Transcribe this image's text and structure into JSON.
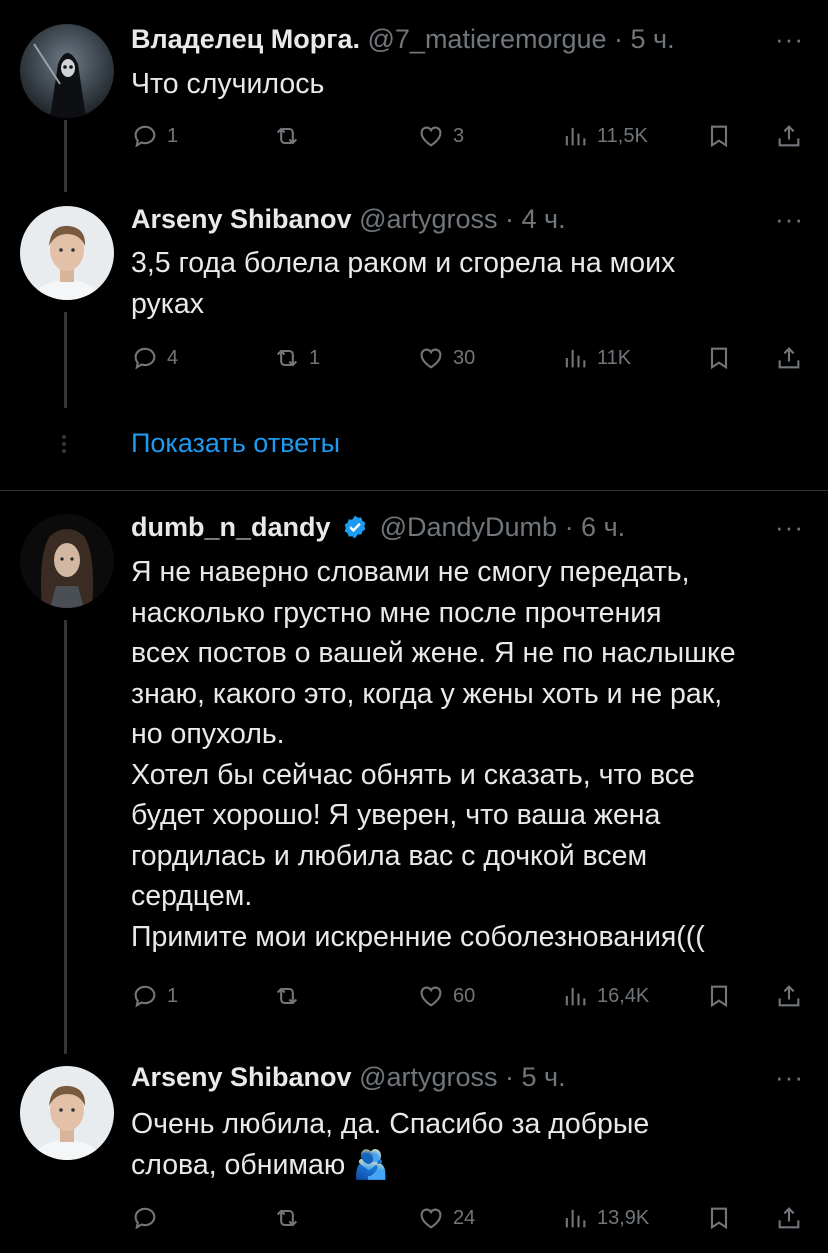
{
  "tweets": [
    {
      "name": "Владелец Морга.",
      "handle": "@7_matieremorgue",
      "time": "· 5 ч.",
      "text": "Что случилось",
      "replies": "1",
      "reposts": "",
      "likes": "3",
      "views": "11,5K"
    },
    {
      "name": "Arseny Shibanov",
      "handle": "@artygross",
      "time": "· 4 ч.",
      "text": "3,5 года болела раком и сгорела на моих\nруках",
      "replies": "4",
      "reposts": "1",
      "likes": "30",
      "views": "11K"
    },
    {
      "name": "dumb_n_dandy",
      "handle": "@DandyDumb",
      "time": "· 6 ч.",
      "text": "Я не наверно словами не смогу передать,\nнасколько грустно мне после прочтения\nвсех постов о вашей жене. Я не по наслышке\nзнаю, какого это, когда у жены хоть и не рак,\nно опухоль.\nХотел бы сейчас обнять и сказать, что все\nбудет хорошо! Я уверен, что ваша жена\nгордилась и любила вас с дочкой всем\nсердцем.\nПримите мои искренние соболезнования(((",
      "replies": "1",
      "reposts": "",
      "likes": "60",
      "views": "16,4K"
    },
    {
      "name": "Arseny Shibanov",
      "handle": "@artygross",
      "time": "· 5 ч.",
      "text": "Очень любила, да. Спасибо за добрые\nслова, обнимаю 🫂",
      "replies": "",
      "reposts": "",
      "likes": "24",
      "views": "13,9K"
    }
  ],
  "show_replies_label": "Показать ответы",
  "more_label": "···",
  "colors": {
    "accent": "#1d9bf0",
    "muted": "#71767b",
    "text": "#e7e9ea",
    "background": "#000000"
  },
  "icons": [
    "reply-icon",
    "repost-icon",
    "like-icon",
    "views-icon",
    "bookmark-icon",
    "share-icon",
    "verified-badge-icon",
    "more-icon"
  ]
}
